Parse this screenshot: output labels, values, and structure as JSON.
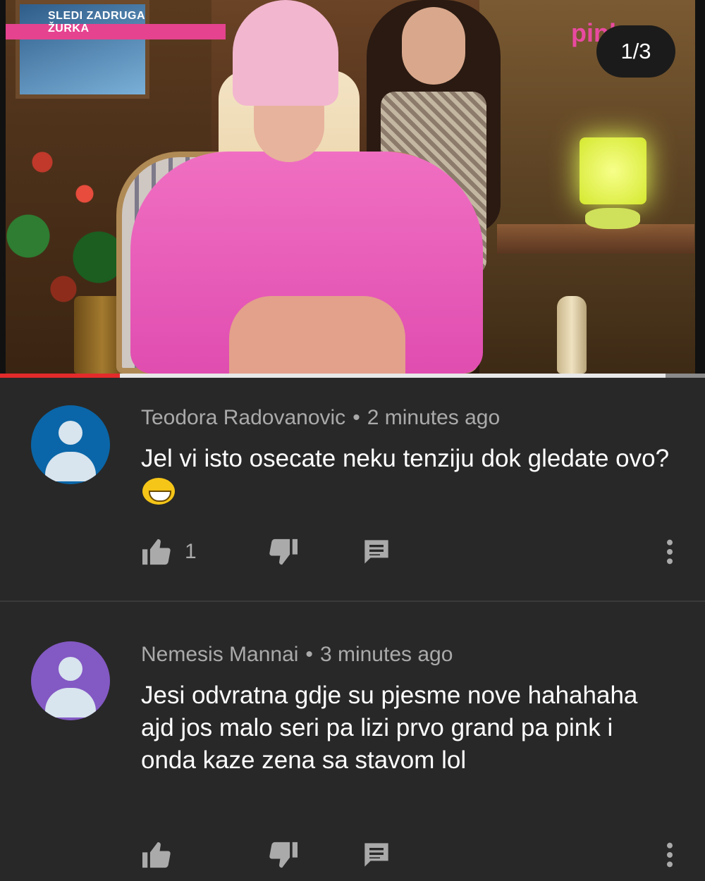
{
  "video": {
    "badge_line1": "SLEDI ZADRUGA",
    "badge_line2": "ŽURKA",
    "channel_logo": "pink",
    "image_counter": "1/3",
    "progress_percent": 17
  },
  "comments": [
    {
      "author": "Teodora Radovanovic",
      "separator": "•",
      "time": "2 minutes ago",
      "text": "Jel vi isto osecate neku tenziju dok gledate ovo?",
      "emoji": "grinning-squinting-face",
      "likes": "1",
      "avatar_color": "#0a66a8"
    },
    {
      "author": "Nemesis Mannai",
      "separator": "•",
      "time": "3 minutes ago",
      "text": "Jesi odvratna gdje su pjesme nove hahahaha ajd jos malo seri pa lizi prvo grand pa pink i onda kaze zena sa stavom lol",
      "likes": "",
      "avatar_color": "#8359c4"
    }
  ],
  "icons": {
    "like": "thumbs-up-icon",
    "dislike": "thumbs-down-icon",
    "reply": "reply-icon",
    "more": "more-vert-icon"
  },
  "colors": {
    "background": "#282828",
    "meta_text": "#aaaaaa",
    "progress_played": "#e32b2b"
  }
}
